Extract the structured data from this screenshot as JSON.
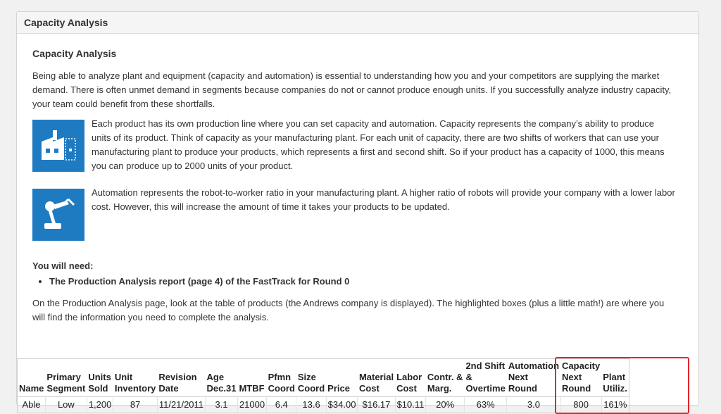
{
  "panel": {
    "title": "Capacity Analysis"
  },
  "content": {
    "heading": "Capacity Analysis",
    "intro": "Being able to analyze plant and equipment (capacity and automation) is essential to understanding how you and your competitors are supplying the market demand. There is often unmet demand in segments because companies do not or cannot produce enough units. If you successfully analyze industry capacity, your team could benefit from these shortfalls.",
    "capacity_text": "Each product has its own production line where you can set capacity and automation.  Capacity represents the company’s ability to produce units of its product. Think of capacity as your manufacturing plant. For each unit of capacity, there are two shifts of workers that can use your manufacturing plant to produce your products, which represents a first and second shift. So if your product has a capacity of 1000, this means you can produce up to 2000 units of your product.",
    "automation_text": "Automation represents the robot-to-worker ratio in your manufacturing plant. A higher ratio of robots will provide your company with a lower labor cost. However, this will increase the amount of time it takes your products to be updated.",
    "need_title": "You will need:",
    "need_items": [
      "The Production Analysis report (page 4) of the FastTrack for Round 0"
    ],
    "instructions": "On the Production Analysis page, look at the table of products (the Andrews company is displayed). The highlighted boxes (plus a little math!) are where you will find the information you need to complete the analysis."
  },
  "icons": {
    "factory": "factory-icon",
    "robot": "robot-arm-icon",
    "accent": "#1f7bc1",
    "highlight": "#e3262c"
  },
  "table": {
    "headers": {
      "name": "Name",
      "segment": [
        "Primary",
        "Segment"
      ],
      "units_sold": [
        "Units",
        "Sold"
      ],
      "inventory": [
        "Unit",
        "Inventory"
      ],
      "revision": [
        "Revision",
        "Date"
      ],
      "age": [
        "Age",
        "Dec.31"
      ],
      "mtbf": "MTBF",
      "pfmn": [
        "Pfmn",
        "Coord"
      ],
      "size": [
        "Size",
        "Coord"
      ],
      "price": "Price",
      "material": [
        "Material",
        "Cost"
      ],
      "labor": [
        "Labor",
        "Cost"
      ],
      "contr": [
        "Contr. &",
        "Marg."
      ],
      "overtime": [
        "2nd Shift",
        "&",
        "Overtime"
      ],
      "automation": [
        "Automation",
        "Next",
        "Round"
      ],
      "capacity": [
        "Capacity",
        "Next",
        "Round"
      ],
      "plant": [
        "Plant",
        "Utiliz."
      ]
    },
    "row": {
      "name": "Able",
      "segment": "Low",
      "units_sold": "1,200",
      "inventory": "87",
      "revision": "11/21/2011",
      "age": "3.1",
      "mtbf": "21000",
      "pfmn": "6.4",
      "size": "13.6",
      "price": "$34.00",
      "material": "$16.17",
      "labor": "$10.11",
      "contr": "20%",
      "overtime": "63%",
      "automation": "3.0",
      "capacity": "800",
      "plant": "161%"
    }
  }
}
